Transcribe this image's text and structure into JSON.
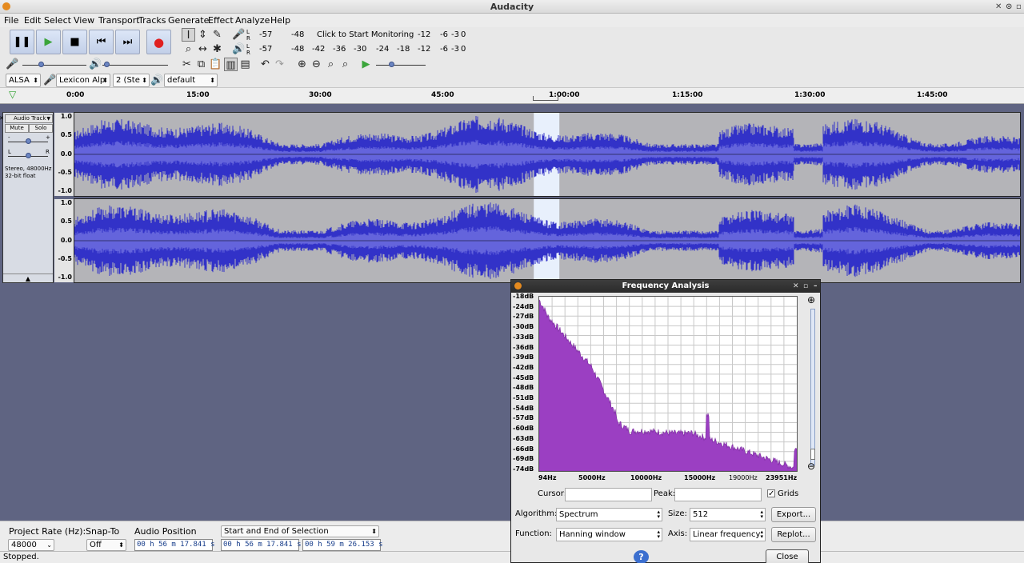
{
  "window": {
    "title": "Audacity"
  },
  "menu": [
    "File",
    "Edit",
    "Select",
    "View",
    "Transport",
    "Tracks",
    "Generate",
    "Effect",
    "Analyze",
    "Help"
  ],
  "meters": {
    "record_ticks": [
      "-57",
      "-48",
      "Click to Start Monitoring",
      "-12",
      "-6",
      "-3",
      "0"
    ],
    "play_ticks": [
      "-57",
      "-48",
      "-42",
      "-36",
      "-30",
      "-24",
      "-18",
      "-12",
      "-6",
      "-3",
      "0"
    ]
  },
  "device": {
    "host": "ALSA",
    "input": "Lexicon Alp",
    "channels": "2 (Ste",
    "output": "default"
  },
  "ruler": {
    "ticks": [
      "0:00",
      "15:00",
      "30:00",
      "45:00",
      "1:00:00",
      "1:15:00",
      "1:30:00",
      "1:45:00"
    ]
  },
  "track": {
    "name": "Audio Track",
    "mute_label": "Mute",
    "solo_label": "Solo",
    "gain_minus": "-",
    "gain_plus": "+",
    "pan_left": "L",
    "pan_right": "R",
    "info_line1": "Stereo, 48000Hz",
    "info_line2": "32-bit float",
    "scale": [
      "1.0",
      "0.5",
      "0.0",
      "-0.5",
      "-1.0"
    ],
    "selection_fraction": [
      0.485,
      0.512
    ]
  },
  "bottom": {
    "project_rate_label": "Project Rate (Hz):",
    "project_rate": "48000",
    "snap_label": "Snap-To",
    "snap_value": "Off",
    "audio_position_label": "Audio Position",
    "selection_mode": "Start and End of Selection",
    "audio_position": "00 h 56 m 17.841 s",
    "sel_start": "00 h 56 m 17.841 s",
    "sel_end": "00 h 59 m 26.153 s"
  },
  "status": "Stopped.",
  "dialog": {
    "title": "Frequency Analysis",
    "y_labels": [
      "-18dB",
      "-24dB",
      "-27dB",
      "-30dB",
      "-33dB",
      "-36dB",
      "-39dB",
      "-42dB",
      "-45dB",
      "-48dB",
      "-51dB",
      "-54dB",
      "-57dB",
      "-60dB",
      "-63dB",
      "-66dB",
      "-69dB",
      "-74dB"
    ],
    "x_labels": [
      "94Hz",
      "5000Hz",
      "10000Hz",
      "15000Hz",
      "19000Hz",
      "23951Hz"
    ],
    "cursor_label": "Cursor:",
    "peak_label": "Peak:",
    "grids_label": "Grids",
    "grids_checked": true,
    "algorithm_label": "Algorithm:",
    "algorithm": "Spectrum",
    "size_label": "Size:",
    "size": "512",
    "export_label": "Export...",
    "function_label": "Function:",
    "function": "Hanning window",
    "axis_label": "Axis:",
    "axis": "Linear frequency",
    "replot_label": "Replot...",
    "help_label": "?",
    "close_label": "Close"
  },
  "colors": {
    "waveform": "#3232c8",
    "waveform_rms": "#6464dc",
    "spectrum": "#9b3fc2",
    "dialog_title": "#2e2e2e",
    "accent": "#6c86c2"
  }
}
